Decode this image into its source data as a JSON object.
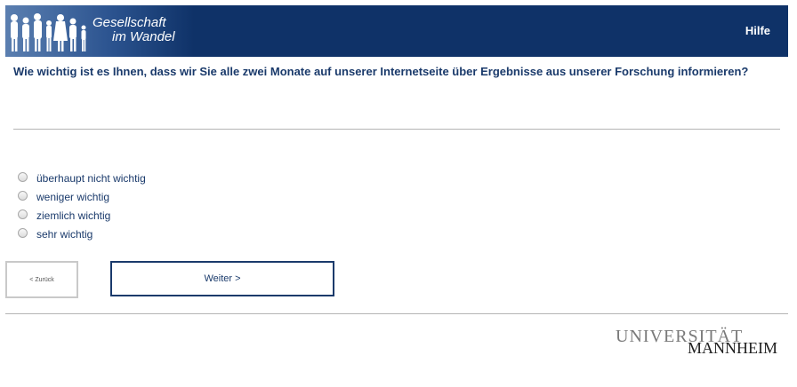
{
  "header": {
    "logo_line1": "Gesellschaft",
    "logo_line2": "im Wandel",
    "help_label": "Hilfe",
    "colors": {
      "bar": "#0f3268",
      "text": "#ffffff"
    }
  },
  "question": {
    "text": "Wie wichtig ist es Ihnen, dass wir Sie alle zwei Monate auf unserer Internetseite über Ergebnisse aus unserer Forschung informieren?"
  },
  "options": [
    {
      "label": "überhaupt nicht wichtig",
      "selected": false
    },
    {
      "label": "weniger wichtig",
      "selected": false
    },
    {
      "label": "ziemlich wichtig",
      "selected": false
    },
    {
      "label": "sehr wichtig",
      "selected": false
    }
  ],
  "navigation": {
    "back_label": "< Zurück",
    "next_label": "Weiter >"
  },
  "footer": {
    "logo_line1": "UNIVERSITÄT",
    "logo_line2": "MANNHEIM"
  },
  "accent_color": "#1a3a6b"
}
